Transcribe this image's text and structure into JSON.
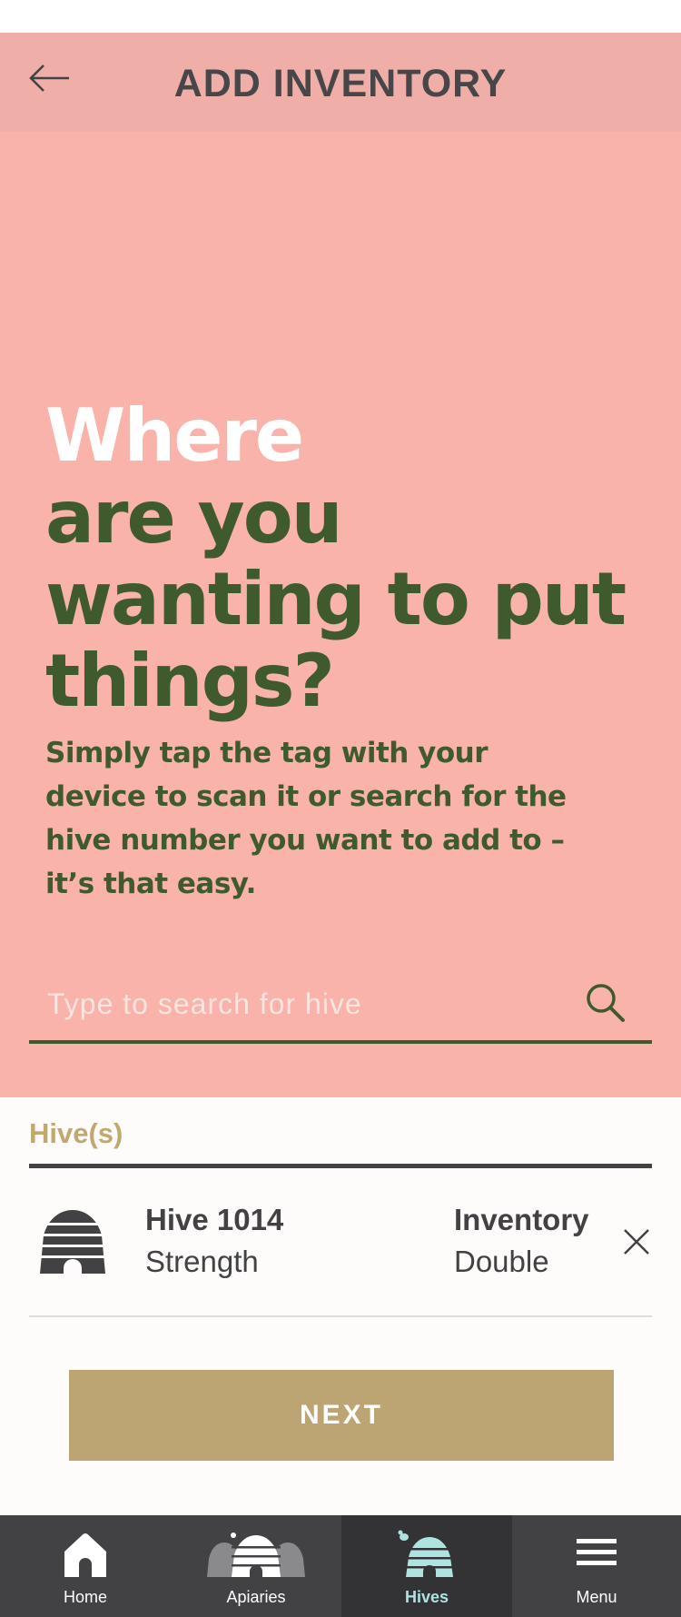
{
  "header": {
    "title": "ADD INVENTORY",
    "back_icon": "arrow-left-icon"
  },
  "hero": {
    "headline_white": "Where",
    "headline_green": "are you wanting to put things?",
    "subtext": "Simply tap the tag with your device to scan it or search for the hive number you want to add to – it’s that easy."
  },
  "search": {
    "placeholder": "Type to search for hive",
    "value": "",
    "icon": "search-icon"
  },
  "hives": {
    "label": "Hive(s)",
    "items": [
      {
        "name": "Hive 1014",
        "subtitle": "Strength",
        "inventory_label": "Inventory",
        "inventory_value": "Double",
        "icon": "beehive-icon",
        "remove_icon": "close-icon"
      }
    ]
  },
  "actions": {
    "next_label": "NEXT"
  },
  "nav": {
    "items": [
      {
        "label": "Home",
        "icon": "home-icon",
        "active": false
      },
      {
        "label": "Apiaries",
        "icon": "apiaries-icon",
        "active": false
      },
      {
        "label": "Hives",
        "icon": "hive-bee-icon",
        "active": true
      },
      {
        "label": "Menu",
        "icon": "hamburger-menu-icon",
        "active": false
      }
    ]
  },
  "colors": {
    "header_bg": "#efafa8",
    "hero_bg": "#f9b3ab",
    "headline_green": "#3f5b2e",
    "accent_gold": "#bca573",
    "label_gold": "#c1a871",
    "text_dark": "#424244",
    "nav_bg": "#424244",
    "nav_active_bg": "#333335",
    "nav_active_text": "#aee3e1"
  }
}
